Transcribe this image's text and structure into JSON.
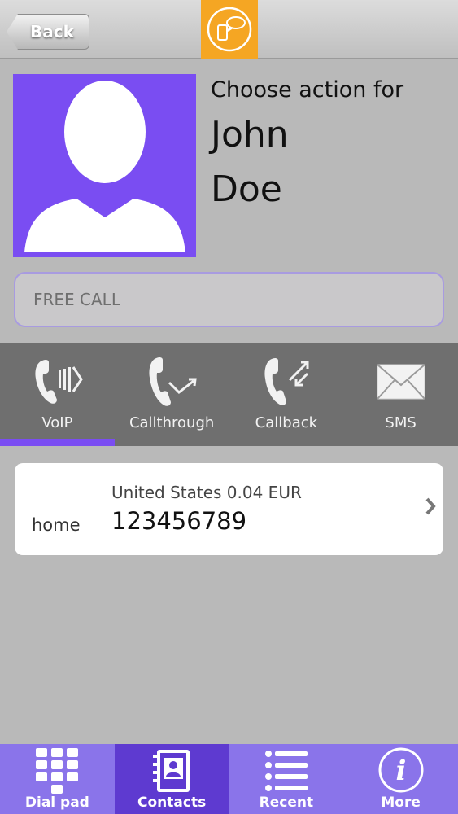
{
  "topbar": {
    "back_label": "Back",
    "logo_icon": "app-logo-icon",
    "logo_color": "#f5a623"
  },
  "contact": {
    "prompt": "Choose action for",
    "first_name": "John",
    "last_name": "Doe",
    "avatar_color": "#7a4df2"
  },
  "free_call": {
    "label": "FREE CALL"
  },
  "modes": [
    {
      "label": "VoIP",
      "icon": "voip-phone-icon",
      "selected": true
    },
    {
      "label": "Callthrough",
      "icon": "callthrough-phone-icon",
      "selected": false
    },
    {
      "label": "Callback",
      "icon": "callback-phone-icon",
      "selected": false
    },
    {
      "label": "SMS",
      "icon": "envelope-icon",
      "selected": false
    }
  ],
  "numbers": [
    {
      "label": "home",
      "rate": "United States 0.04 EUR",
      "number": "123456789"
    }
  ],
  "bottom_nav": [
    {
      "label": "Dial pad",
      "icon": "keypad-icon",
      "active": false
    },
    {
      "label": "Contacts",
      "icon": "contacts-book-icon",
      "active": true
    },
    {
      "label": "Recent",
      "icon": "list-icon",
      "active": false
    },
    {
      "label": "More",
      "icon": "info-icon",
      "active": false
    }
  ],
  "colors": {
    "accent": "#7a4df2",
    "nav_bg": "#8a74ea",
    "nav_active": "#5e3ad0",
    "modes_bg": "#6f6f6f",
    "page_bg": "#b9b9b9"
  }
}
